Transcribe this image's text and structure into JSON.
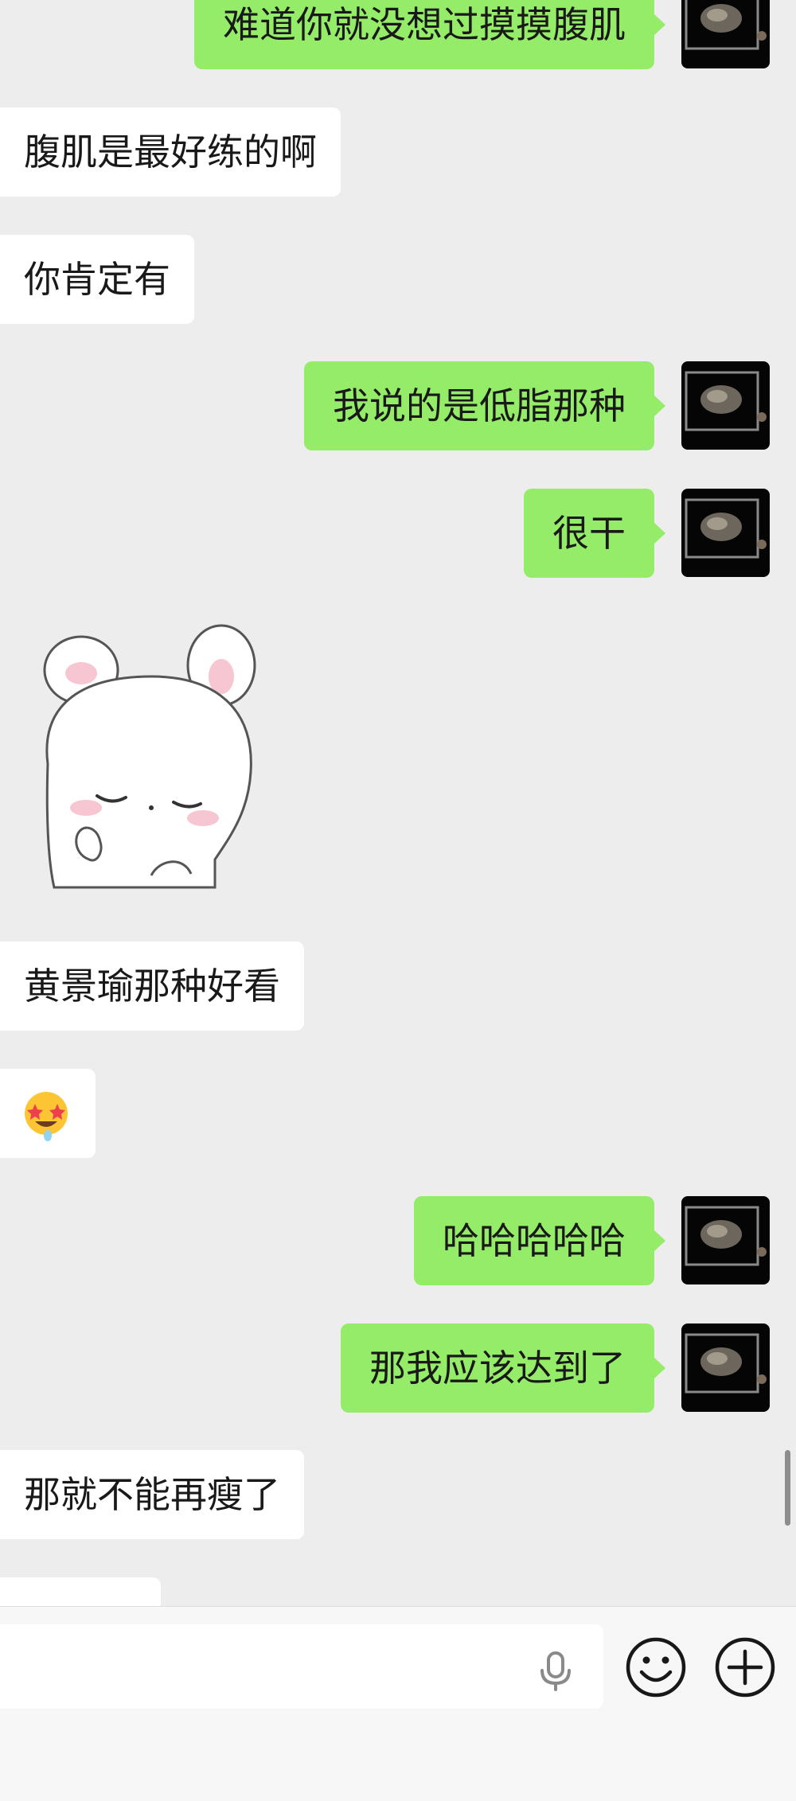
{
  "chat": {
    "messages": [
      {
        "side": "out",
        "text": "难道你就没想过摸摸腹肌"
      },
      {
        "side": "in",
        "text": "腹肌是最好练的啊"
      },
      {
        "side": "in",
        "text": "你肯定有"
      },
      {
        "side": "out",
        "text": "我说的是低脂那种"
      },
      {
        "side": "out",
        "text": "很干"
      },
      {
        "side": "in",
        "type": "sticker",
        "sticker_name": "sleepy-bunny-sticker"
      },
      {
        "side": "in",
        "text": "黄景瑜那种好看"
      },
      {
        "side": "in",
        "type": "emoji",
        "emoji": "🤩"
      },
      {
        "side": "out",
        "text": "哈哈哈哈哈"
      },
      {
        "side": "out",
        "text": "那我应该达到了"
      },
      {
        "side": "in",
        "text": "那就不能再瘦了"
      }
    ]
  },
  "input_bar": {
    "value": "",
    "icons": [
      "mic-icon",
      "emoji-icon",
      "plus-icon"
    ]
  },
  "colors": {
    "background": "#ededed",
    "outgoing_bubble": "#95ec69",
    "incoming_bubble": "#ffffff",
    "avatar": "#050505"
  }
}
